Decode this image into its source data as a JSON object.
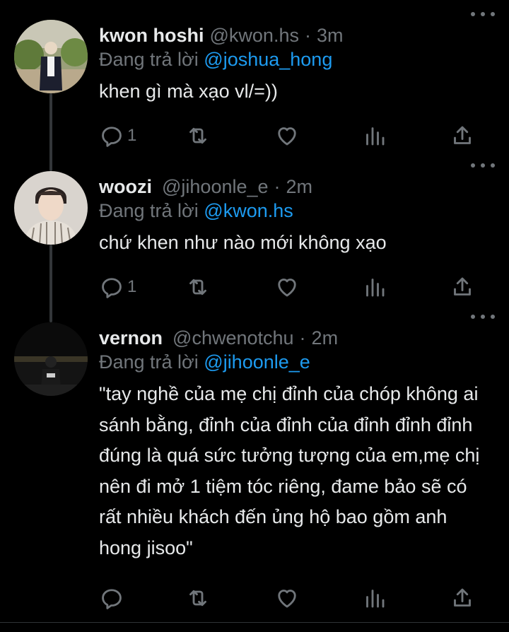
{
  "tweets": [
    {
      "name": "kwon hoshi",
      "handle": "@kwon.hs",
      "separator": "·",
      "time": "3m",
      "reply_prefix": "Đang trả lời",
      "reply_handle": "@joshua_hong",
      "text": "khen gì mà xạo vl/=))",
      "reply_count": "1"
    },
    {
      "name": "woozi",
      "handle": "@jihoonle_e",
      "separator": "·",
      "time": "2m",
      "reply_prefix": "Đang trả lời",
      "reply_handle": "@kwon.hs",
      "text": "chứ khen như nào mới không xạo",
      "reply_count": "1"
    },
    {
      "name": "vernon",
      "handle": "@chwenotchu",
      "separator": "·",
      "time": "2m",
      "reply_prefix": "Đang trả lời",
      "reply_handle": "@jihoonle_e",
      "text": "\"tay nghề của mẹ chị đỉnh của chóp không ai sánh bằng, đỉnh của đỉnh của đỉnh đỉnh đỉnh đúng là quá sức tưởng tượng của em,mẹ chị nên đi mở 1 tiệm tóc riêng, đame bảo sẽ có rất nhiều khách đến ủng hộ bao gồm anh hong jisoo\"",
      "reply_count": ""
    }
  ],
  "icons": [
    "reply-icon",
    "retweet-icon",
    "like-icon",
    "views-icon",
    "share-icon",
    "more-icon"
  ],
  "colors": {
    "background": "#000000",
    "text": "#e7e9ea",
    "secondary": "#71767b",
    "link": "#1d9bf0",
    "thread_line": "#333639"
  }
}
